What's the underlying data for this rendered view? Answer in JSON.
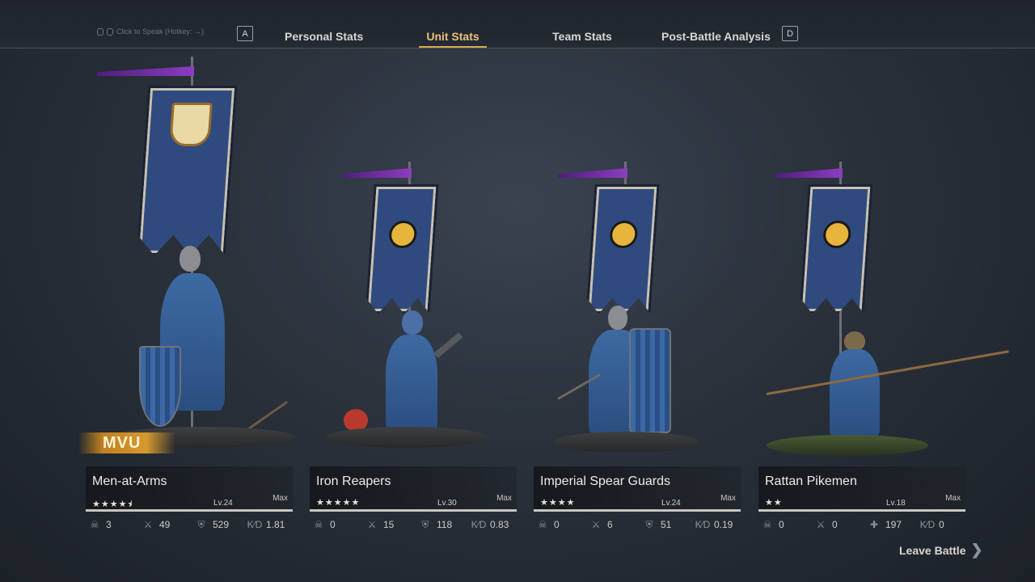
{
  "header": {
    "voice_hint": "Click to Speak (Hotkey: →)",
    "key_left": "A",
    "key_right": "D",
    "tabs": [
      {
        "label": "Personal Stats"
      },
      {
        "label": "Unit Stats"
      },
      {
        "label": "Team Stats"
      },
      {
        "label": "Post-Battle Analysis"
      }
    ]
  },
  "units": [
    {
      "name": "Men-at-Arms",
      "stars": "★★★★⯨",
      "level": "Lv.24",
      "max": "Max",
      "xp_progress": 1.0,
      "stats": {
        "kills": "3",
        "assists": "49",
        "damage": "529",
        "kd": "1.81"
      }
    },
    {
      "name": "Iron Reapers",
      "stars": "★★★★★",
      "level": "Lv.30",
      "max": "Max",
      "xp_progress": 1.0,
      "stats": {
        "kills": "0",
        "assists": "15",
        "damage": "118",
        "kd": "0.83"
      }
    },
    {
      "name": "Imperial Spear Guards",
      "stars": "★★★★",
      "level": "Lv.24",
      "max": "Max",
      "xp_progress": 1.0,
      "stats": {
        "kills": "0",
        "assists": "6",
        "damage": "51",
        "kd": "0.19"
      }
    },
    {
      "name": "Rattan Pikemen",
      "stars": "★★",
      "level": "Lv.18",
      "max": "Max",
      "xp_progress": 1.0,
      "stats": {
        "kills": "0",
        "assists": "0",
        "damage": "197",
        "kd": "0"
      }
    }
  ],
  "mvu_label": "MVU",
  "leave_label": "Leave Battle",
  "stat_icons": {
    "kills": "skull-icon",
    "assists": "crossed-swords-icon",
    "damage": "shield-icon",
    "kd": "kd-ratio-icon",
    "damage_alt": "cross-icon"
  },
  "colors": {
    "active_tab": "#e8c27a",
    "mvu_gold": "#d7992e",
    "banner_blue": "#2f4a7e",
    "pennant_purple": "#8c3dc0"
  }
}
